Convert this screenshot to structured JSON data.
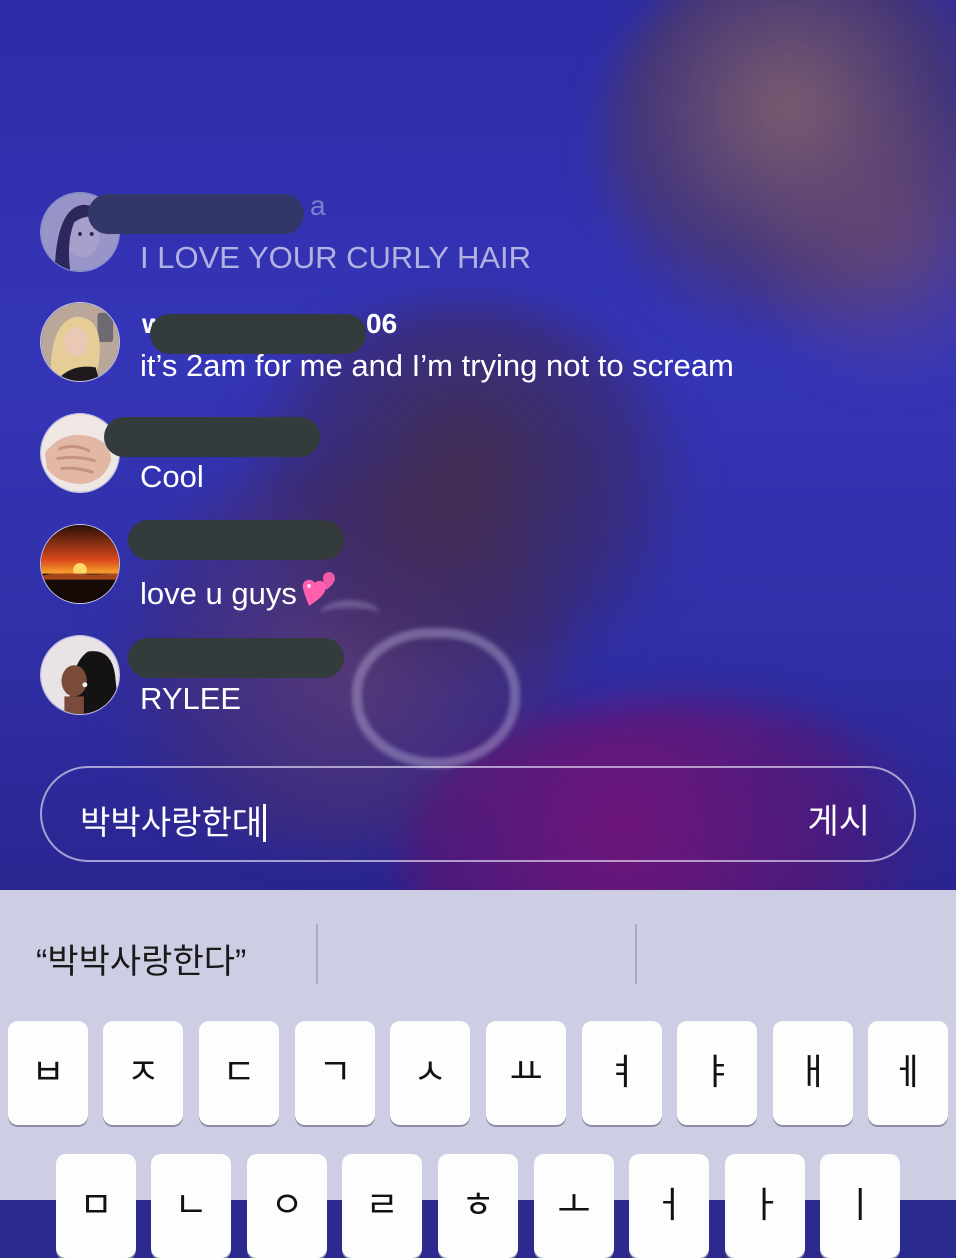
{
  "comments": [
    {
      "name_tail": "a",
      "text": "I LOVE YOUR CURLY HAIR"
    },
    {
      "name_start": "w",
      "name_end": "06",
      "text": "it’s 2am for me and I’m trying not to scream"
    },
    {
      "text": "Cool"
    },
    {
      "text": "love u guys"
    },
    {
      "text": "RYLEE"
    }
  ],
  "input": {
    "value": "박박사랑한대",
    "post_label": "게시"
  },
  "keyboard": {
    "suggestion": "“박박사랑한다”",
    "row1": [
      "ㅂ",
      "ㅈ",
      "ㄷ",
      "ㄱ",
      "ㅅ",
      "ㅛ",
      "ㅕ",
      "ㅑ",
      "ㅐ",
      "ㅔ"
    ],
    "row2": [
      "ㅁ",
      "ㄴ",
      "ㅇ",
      "ㄹ",
      "ㅎ",
      "ㅗ",
      "ㅓ",
      "ㅏ",
      "ㅣ"
    ]
  },
  "icons": {
    "heart": "two-hearts-emoji",
    "text_cursor": "caret"
  },
  "colors": {
    "accent_input_border": "#e6e1f5",
    "keyboard_bg": "#cdcde3",
    "key_bg": "#fdfdfe",
    "redaction": "#333b3d"
  }
}
